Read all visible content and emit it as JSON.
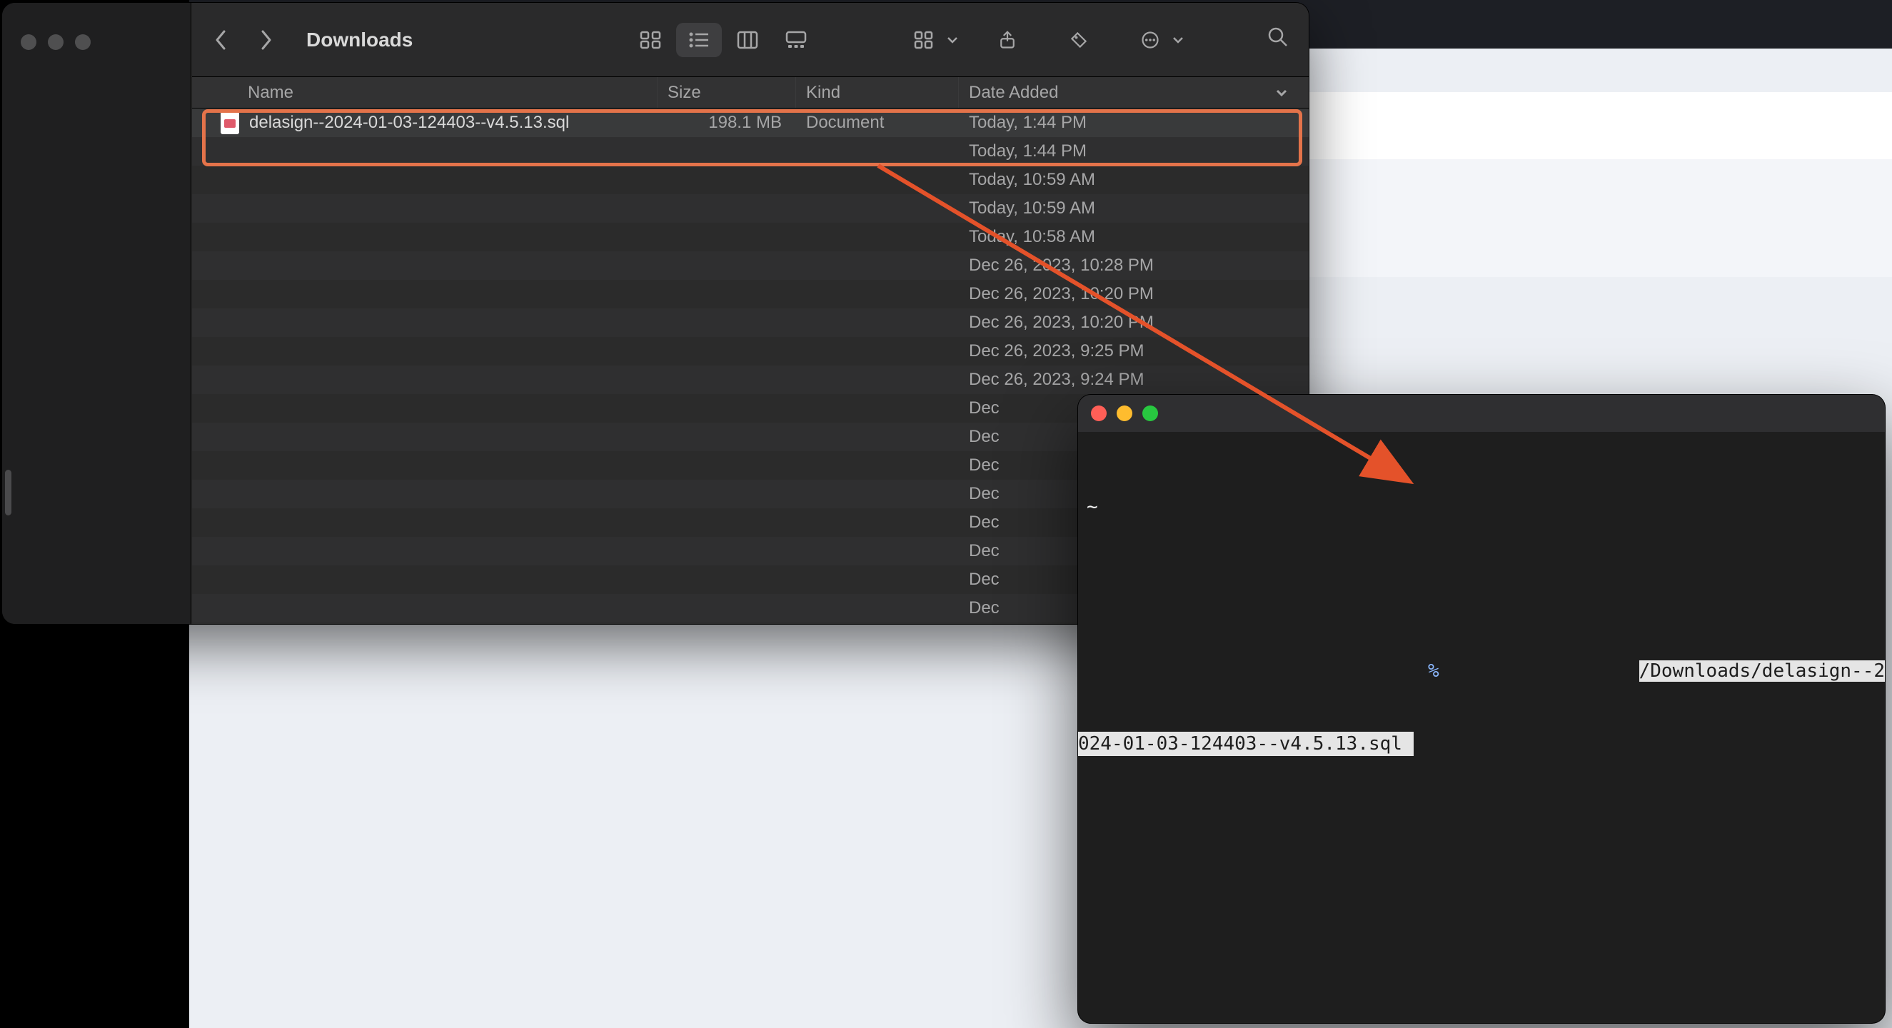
{
  "finder": {
    "title": "Downloads",
    "columns": {
      "name": "Name",
      "size": "Size",
      "kind": "Kind",
      "date": "Date Added"
    },
    "rows": [
      {
        "name": "delasign--2024-01-03-124403--v4.5.13.sql",
        "size": "198.1 MB",
        "kind": "Document",
        "date": "Today, 1:44 PM",
        "selected": true,
        "show_icon": true
      },
      {
        "date": "Today, 1:44 PM"
      },
      {
        "date": "Today, 10:59 AM"
      },
      {
        "date": "Today, 10:59 AM"
      },
      {
        "date": "Today, 10:58 AM"
      },
      {
        "date": "Dec 26, 2023, 10:28 PM"
      },
      {
        "date": "Dec 26, 2023, 10:20 PM"
      },
      {
        "date": "Dec 26, 2023, 10:20 PM"
      },
      {
        "date": "Dec 26, 2023, 9:25 PM"
      },
      {
        "date": "Dec 26, 2023, 9:24 PM"
      },
      {
        "date": "Dec"
      },
      {
        "date": "Dec"
      },
      {
        "date": "Dec"
      },
      {
        "date": "Dec"
      },
      {
        "date": "Dec"
      },
      {
        "date": "Dec"
      },
      {
        "date": "Dec"
      },
      {
        "date": "Dec"
      }
    ]
  },
  "terminal": {
    "line1_tilde": "~",
    "prompt_symbol": "%",
    "arg_right": "/Downloads/delasign--2",
    "arg_left": "024-01-03-124403--v4.5.13.sql "
  }
}
